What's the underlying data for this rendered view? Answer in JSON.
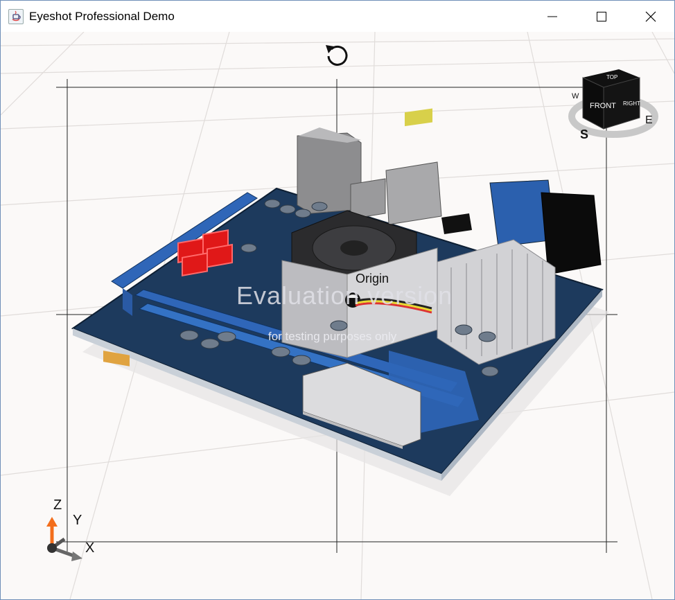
{
  "window": {
    "title": "Eyeshot Professional Demo",
    "controls": {
      "minimize": "minimize",
      "maximize": "maximize",
      "close": "close"
    }
  },
  "viewport": {
    "watermark": {
      "title": "Evaluation version",
      "subtitle": "for testing purposes only"
    },
    "origin_label": "Origin",
    "navigation_cube": {
      "front": "FRONT",
      "top": "TOP",
      "right": "RIGHT",
      "compass": {
        "south": "S",
        "east": "E",
        "west": "W"
      }
    },
    "axes_triad": {
      "x": "X",
      "y": "Y",
      "z": "Z"
    }
  },
  "colors": {
    "board": "#1e3a5c",
    "pcie": "#2f66b8",
    "sata": "#e01818",
    "heatsink": "#cfcfd2",
    "accent_z": "#f36e1c"
  },
  "icons": [
    "java-app-icon",
    "reset-view-icon",
    "minimize-icon",
    "maximize-icon",
    "close-icon"
  ]
}
